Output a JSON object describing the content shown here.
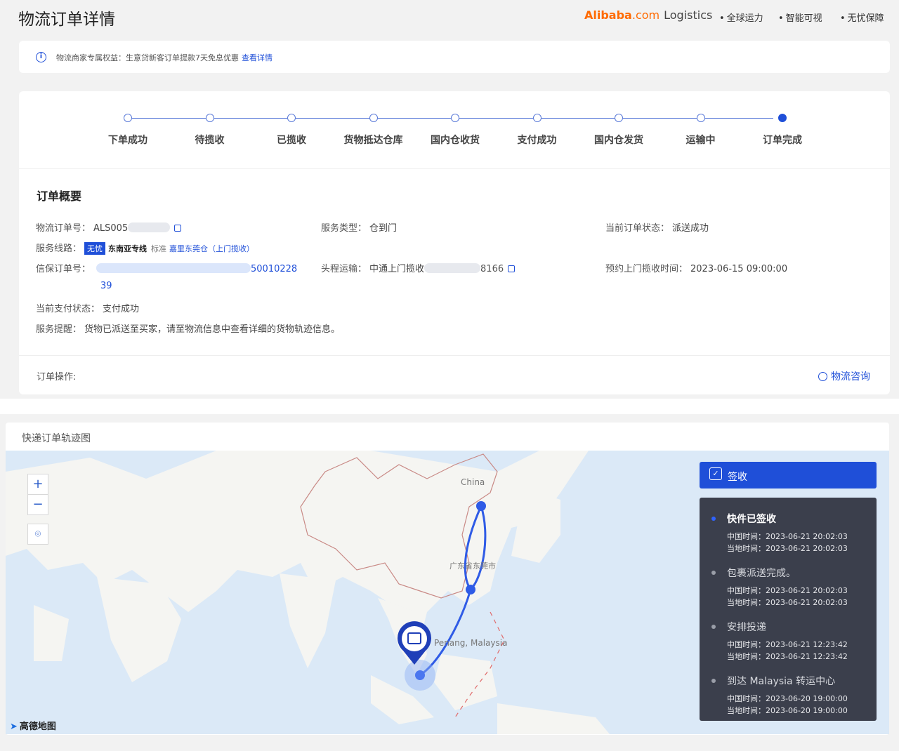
{
  "header": {
    "title": "物流订单详情",
    "brand": {
      "part1": "Alibaba",
      "part2": ".com",
      "part3": "Logistics"
    },
    "features": [
      "全球运力",
      "智能可视",
      "无忧保障"
    ]
  },
  "notice": {
    "text": "物流商家专属权益：生意贷新客订单提款7天免息优惠",
    "link": "查看详情"
  },
  "steps": {
    "items": [
      "下单成功",
      "待揽收",
      "已揽收",
      "货物抵达仓库",
      "国内仓收货",
      "支付成功",
      "国内仓发货",
      "运输中",
      "订单完成"
    ],
    "current": 8
  },
  "overview": {
    "title": "订单概要",
    "logistics_order": {
      "label": "物流订单号：",
      "value": "ALS005"
    },
    "service_type": {
      "label": "服务类型：",
      "value": "仓到门"
    },
    "order_status": {
      "label": "当前订单状态：",
      "value": "派送成功"
    },
    "route": {
      "label": "服务线路：",
      "tag": "无忧",
      "name": "东南亚专线",
      "level": "标准",
      "warehouse": "嘉里东莞仓（上门揽收）"
    },
    "trade_order": {
      "label": "信保订单号：",
      "value_tail": "50010228",
      "value_line2": "39"
    },
    "first_leg": {
      "label": "头程运输：",
      "value": "中通上门揽收",
      "value_tail": "8166"
    },
    "pickup_time": {
      "label": "预约上门揽收时间：",
      "value": "2023-06-15 09:00:00"
    },
    "pay_status": {
      "label": "当前支付状态：",
      "value": "支付成功"
    },
    "reminder": {
      "label": "服务提醒：",
      "value": "货物已派送至买家，请至物流信息中查看详细的货物轨迹信息。"
    },
    "ops_label": "订单操作:",
    "consult_button": "物流咨询"
  },
  "map": {
    "title": "快递订单轨迹图",
    "zoom_in": "+",
    "zoom_out": "−",
    "labels": {
      "china": "China",
      "city": "广东省东莞市",
      "penang": "Penang, Malaysia"
    },
    "attribution": "高德地图",
    "sign_button": "签收",
    "events": [
      {
        "title": "快件已签收",
        "cn_time": "中国时间：2023-06-21 20:02:03",
        "local_time": "当地时间：2023-06-21 20:02:03"
      },
      {
        "title": "包裹派送完成。",
        "cn_time": "中国时间：2023-06-21 20:02:03",
        "local_time": "当地时间：2023-06-21 20:02:03"
      },
      {
        "title": "安排投递",
        "cn_time": "中国时间：2023-06-21 12:23:42",
        "local_time": "当地时间：2023-06-21 12:23:42"
      },
      {
        "title": "到达 Malaysia 转运中心",
        "cn_time": "中国时间：2023-06-20 19:00:00",
        "local_time": "当地时间：2023-06-20 19:00:00"
      }
    ]
  },
  "colors": {
    "primary": "#1f4fd8",
    "brand": "#ff6a00",
    "panel": "#3b3f4c",
    "map_sea": "#dbe9f7"
  }
}
